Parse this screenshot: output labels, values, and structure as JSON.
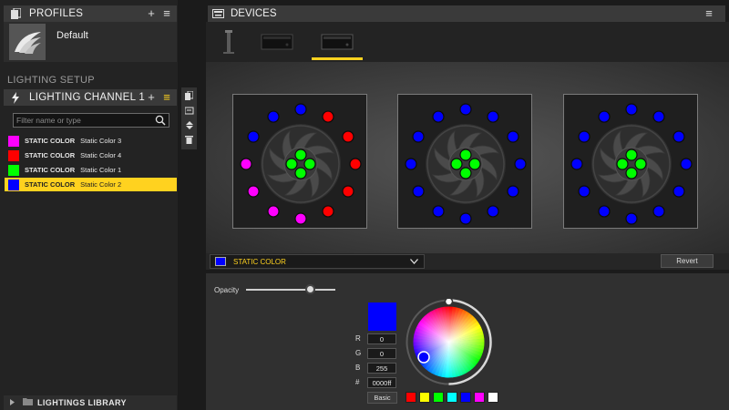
{
  "profiles": {
    "title": "PROFILES",
    "add_symbol": "+",
    "menu_symbol": "≡",
    "items": [
      {
        "name": "Default"
      }
    ]
  },
  "lighting_setup": {
    "label": "LIGHTING SETUP"
  },
  "channel": {
    "title": "LIGHTING CHANNEL 1",
    "add_symbol": "+",
    "menu_symbol": "≡",
    "accent": "#ffd21f"
  },
  "search": {
    "placeholder": "Filter name or type"
  },
  "layers": [
    {
      "type": "STATIC COLOR",
      "name": "Static Color 3",
      "color": "#ff00ff",
      "selected": false
    },
    {
      "type": "STATIC COLOR",
      "name": "Static Color 4",
      "color": "#ff0000",
      "selected": false
    },
    {
      "type": "STATIC COLOR",
      "name": "Static Color 1",
      "color": "#00ff00",
      "selected": false
    },
    {
      "type": "STATIC COLOR",
      "name": "Static Color 2",
      "color": "#0000ff",
      "selected": true
    }
  ],
  "library": {
    "title": "LIGHTINGS LIBRARY"
  },
  "devices": {
    "title": "DEVICES",
    "menu_symbol": "≡",
    "active_index": 2,
    "thumb_count": 3
  },
  "fans": [
    {
      "ring": [
        "#ff0000",
        "#ff0000",
        "#ff0000",
        "#ff0000",
        "#ff0000",
        "#ff00ff",
        "#ff00ff",
        "#ff00ff",
        "#ff00ff",
        "#0000ff",
        "#0000ff",
        "#0000ff"
      ],
      "center": "#00ff00"
    },
    {
      "ring": [
        "#0000ff",
        "#0000ff",
        "#0000ff",
        "#0000ff",
        "#0000ff",
        "#0000ff",
        "#0000ff",
        "#0000ff",
        "#0000ff",
        "#0000ff",
        "#0000ff",
        "#0000ff"
      ],
      "center": "#00ff00"
    },
    {
      "ring": [
        "#0000ff",
        "#0000ff",
        "#0000ff",
        "#0000ff",
        "#0000ff",
        "#0000ff",
        "#0000ff",
        "#0000ff",
        "#0000ff",
        "#0000ff",
        "#0000ff",
        "#0000ff"
      ],
      "center": "#00ff00"
    }
  ],
  "effect": {
    "label": "STATIC COLOR",
    "color": "#0000ff"
  },
  "revert": {
    "label": "Revert"
  },
  "opacity": {
    "label": "Opacity",
    "value": 0.72
  },
  "color": {
    "hex_preview": "#0000ff",
    "r_label": "R",
    "g_label": "G",
    "b_label": "B",
    "hex_label": "#",
    "r": "0",
    "g": "0",
    "b": "255",
    "hex": "0000ff"
  },
  "basic": {
    "label": "Basic"
  },
  "palette": [
    "#ff0000",
    "#ffff00",
    "#00ff00",
    "#00ffff",
    "#0000ff",
    "#ff00ff",
    "#ffffff"
  ]
}
